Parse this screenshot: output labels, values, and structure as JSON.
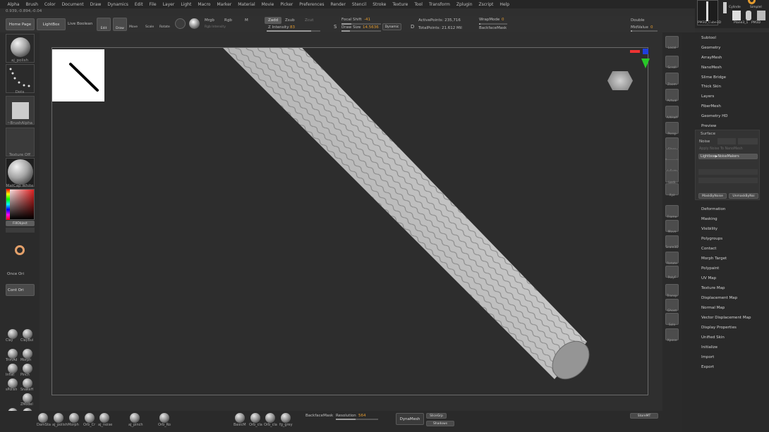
{
  "menu": [
    "Alpha",
    "Brush",
    "Color",
    "Document",
    "Draw",
    "Dynamics",
    "Edit",
    "File",
    "Layer",
    "Light",
    "Macro",
    "Marker",
    "Material",
    "Movie",
    "Picker",
    "Preferences",
    "Render",
    "Stencil",
    "Stroke",
    "Texture",
    "Tool",
    "Transform",
    "Zplugin",
    "Zscript",
    "Help"
  ],
  "coords": "0.939,-0.894,-0.04",
  "toolbar": {
    "home": "Home Page",
    "lightbox": "LightBox",
    "live_boolean": "Live Boolean",
    "edit": "Edit",
    "draw": "Draw",
    "move": "Move",
    "scale": "Scale",
    "rotate": "Rotate",
    "mrgb": "Mrgb",
    "rgb": "Rgb",
    "m": "M",
    "rgb_intensity": "Rgb Intensity",
    "zadd": "Zadd",
    "zsub": "Zsub",
    "zcut": "Zcut",
    "z_intensity": "Z Intensity",
    "z_intensity_val": "83",
    "focal_shift": "Focal Shift",
    "focal_shift_val": "-41",
    "draw_size": "Draw Size",
    "draw_size_val": "14.5636",
    "dynamic": "Dynamic",
    "active_points": "ActivePoints: 235,716",
    "total_points": "TotalPoints: 21.612 Mil",
    "wrapmode": "WrapMode",
    "wrapmode_val": "0",
    "backfacemask": "BackfaceMask",
    "double": "Double",
    "midvalue": "MidValue",
    "midvalue_val": "0",
    "s": "S",
    "d": "D"
  },
  "left": {
    "brush": "aj_polish",
    "stroke": "Dots",
    "alpha": "~BrushAlpha",
    "texture": "Texture Off",
    "material": "MatCap White",
    "fill": "FillObject",
    "once": "Once Ori",
    "cont": "Cont Ori",
    "brushes": [
      "Clay",
      "ClayBui",
      "TrimAd",
      "Morph",
      "Inflat",
      "Pinch",
      "sPolish",
      "SnakeH",
      "ZModel",
      "Morph",
      "Orb_Cr"
    ]
  },
  "tool_thumbs": [
    "PM3D_Cube3D",
    "Plane3_1",
    "PM3D",
    "Cylinde",
    "SimpleI"
  ],
  "strip": [
    "Local",
    "Scroll",
    "Zoom",
    "Actual",
    "AAHalf",
    "Persp",
    "Floor",
    "Dynamic",
    "L.Sym",
    "Lock",
    "Xyz",
    "Frame",
    "Move",
    "Scale3D",
    "Rotate",
    "PolyF",
    "Transp",
    "Ghost",
    "Solo",
    "Xpose"
  ],
  "right": {
    "top": [
      "Subtool",
      "Geometry",
      "ArrayMesh",
      "NanoMesh",
      "Slime Bridge",
      "Thick Skin",
      "Layers",
      "FiberMesh",
      "Geometry HD",
      "Preview"
    ],
    "surface": "Surface",
    "noise": "Noise",
    "apply_noise": "Apply Noise To NanoMesh",
    "lightbox_noise": "Lightbox▶NoiseMakers",
    "mask_by_noise": "MaskByNoise",
    "unmask_by_noise": "UnmaskByNoi",
    "bottom": [
      "Deformation",
      "Masking",
      "Visibility",
      "Polygroups",
      "Contact",
      "Morph Target",
      "Polypaint",
      "UV Map",
      "Texture Map",
      "Displacement Map",
      "Normal Map",
      "Vector Displacement Map",
      "Display Properties",
      "Unified Skin",
      "Initialize",
      "Import",
      "Export"
    ]
  },
  "bottom": {
    "brushes": [
      "DamSta",
      "aj_polish",
      "Morph",
      "Orb_Cr",
      "aj_noise",
      "aj_pinch",
      "Orb_Ro",
      "BasicM",
      "Orb_cla",
      "Orb_cla",
      "fg_grey"
    ],
    "backfacemask": "BackfaceMask",
    "resolution": "Resolution",
    "resolution_val": "564",
    "dynamesh": "DynaMesh",
    "groups": "SliceGrp",
    "shadows": "Shadows",
    "storemt": "StoreMT"
  },
  "colors": {
    "accent": "#e39b2f",
    "bg": "#2d2d2d"
  }
}
